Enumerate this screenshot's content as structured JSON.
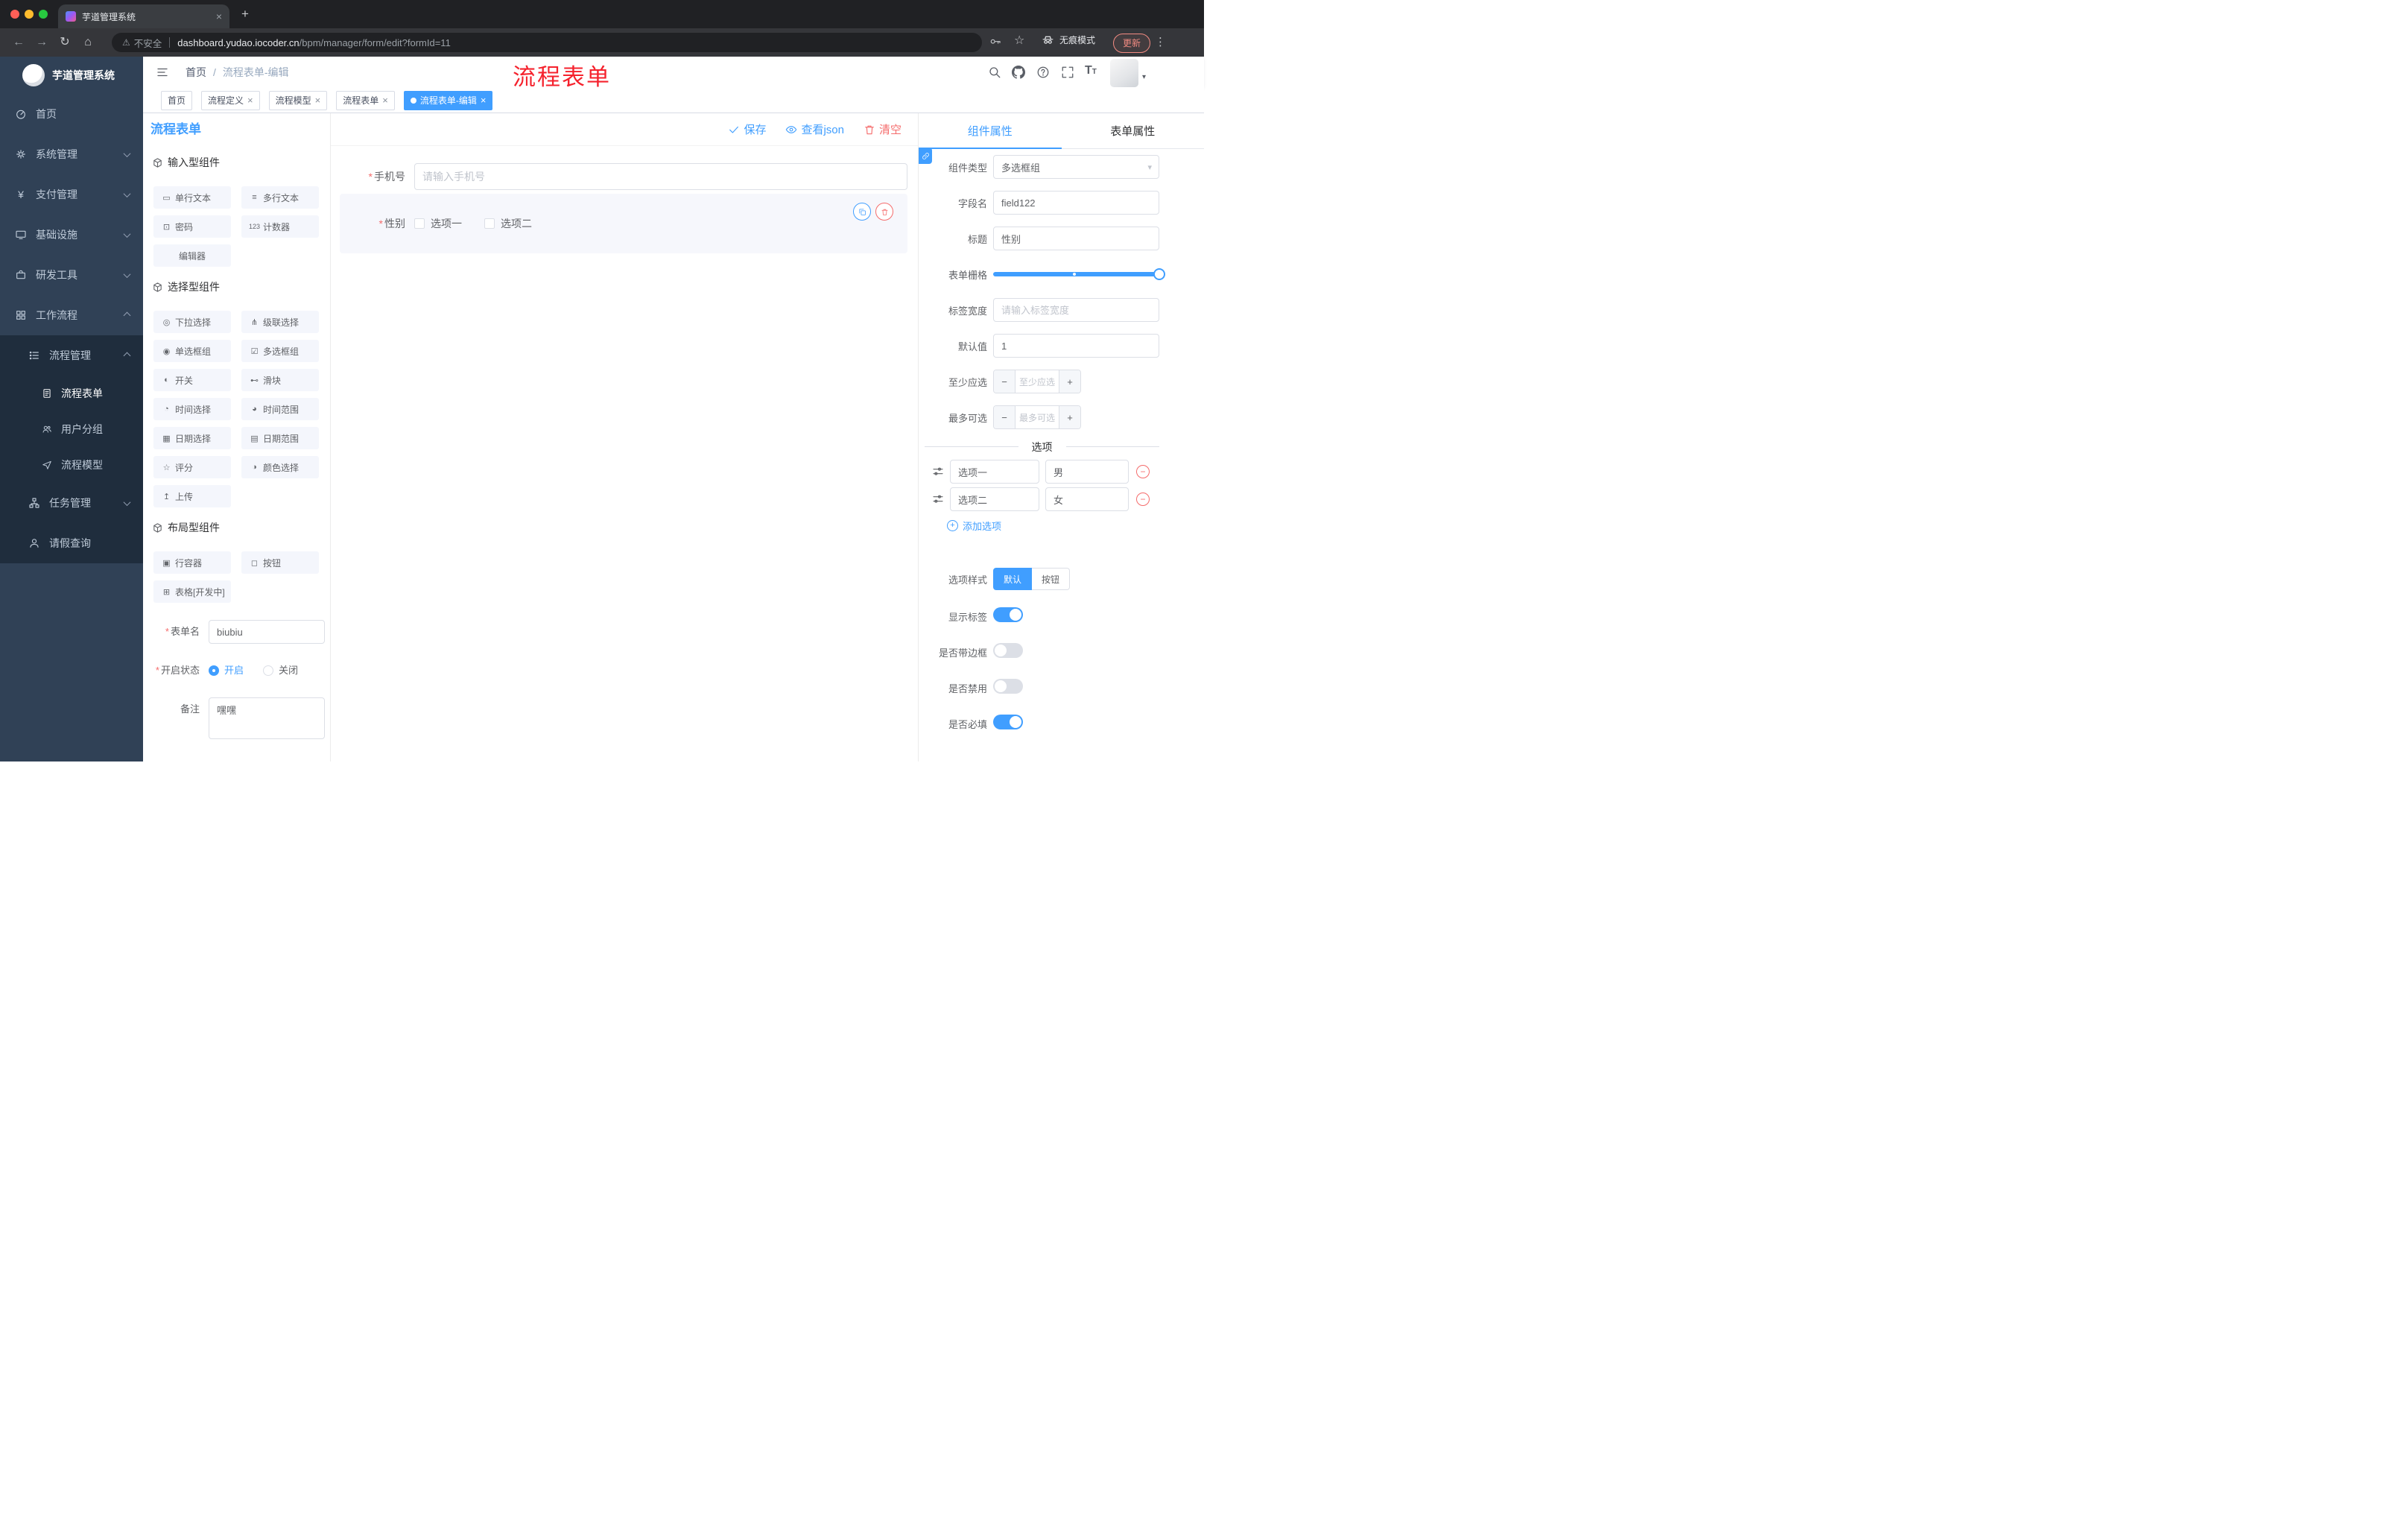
{
  "theme": {
    "accent": "#409EFF",
    "danger": "#F56C6C",
    "annotation_red": "#F5222D",
    "sidebar_bg": "#304156",
    "submenu_bg": "#1F2D3D"
  },
  "glyphs": {
    "close": "×",
    "plus": "+",
    "minus": "−",
    "back": "←",
    "forward": "→",
    "reload": "↻",
    "home": "⌂",
    "star": "☆",
    "menu_dots": "⋮",
    "caret_down": "▾",
    "slash": "/",
    "warning": "⚠",
    "yen": "¥",
    "required": "*"
  },
  "browser": {
    "tab_title": "芋道管理系统",
    "security_label": "不安全",
    "url_host": "dashboard.yudao.iocoder.cn",
    "url_path": "/bpm/manager/form/edit?formId=11",
    "incognito_label": "无痕模式",
    "update_label": "更新"
  },
  "sidebar": {
    "logo_title": "芋道管理系统",
    "items": [
      {
        "label": "首页"
      },
      {
        "label": "系统管理"
      },
      {
        "label": "支付管理"
      },
      {
        "label": "基础设施"
      },
      {
        "label": "研发工具"
      },
      {
        "label": "工作流程"
      },
      {
        "label": "流程管理"
      },
      {
        "label": "流程表单"
      },
      {
        "label": "用户分组"
      },
      {
        "label": "流程模型"
      },
      {
        "label": "任务管理"
      },
      {
        "label": "请假查询"
      }
    ]
  },
  "header": {
    "breadcrumb": [
      "首页",
      "流程表单-编辑"
    ],
    "annotation": "流程表单"
  },
  "tags": [
    {
      "label": "首页"
    },
    {
      "label": "流程定义"
    },
    {
      "label": "流程模型"
    },
    {
      "label": "流程表单"
    },
    {
      "label": "流程表单-编辑"
    }
  ],
  "designer": {
    "title": "流程表单",
    "actions": {
      "save": "保存",
      "view_json": "查看json",
      "clear": "清空"
    },
    "groups": [
      {
        "title": "输入型组件",
        "items": [
          {
            "label": "单行文本",
            "icon": "▭"
          },
          {
            "label": "多行文本",
            "icon": "≡"
          },
          {
            "label": "密码",
            "icon": "⊡"
          },
          {
            "label": "计数器",
            "icon": "123"
          },
          {
            "label": "编辑器",
            "icon": ""
          }
        ]
      },
      {
        "title": "选择型组件",
        "items": [
          {
            "label": "下拉选择",
            "icon": "◎"
          },
          {
            "label": "级联选择",
            "icon": "⋔"
          },
          {
            "label": "单选框组",
            "icon": "◉"
          },
          {
            "label": "多选框组",
            "icon": "☑"
          },
          {
            "label": "开关",
            "icon": "◐"
          },
          {
            "label": "滑块",
            "icon": "⊷"
          },
          {
            "label": "时间选择",
            "icon": "◔"
          },
          {
            "label": "时间范围",
            "icon": "◕"
          },
          {
            "label": "日期选择",
            "icon": "▦"
          },
          {
            "label": "日期范围",
            "icon": "▤"
          },
          {
            "label": "评分",
            "icon": "☆"
          },
          {
            "label": "颜色选择",
            "icon": "◑"
          },
          {
            "label": "上传",
            "icon": "↥"
          }
        ]
      },
      {
        "title": "布局型组件",
        "items": [
          {
            "label": "行容器",
            "icon": "▣"
          },
          {
            "label": "按钮",
            "icon": "◻"
          },
          {
            "label": "表格[开发中]",
            "icon": "⊞"
          }
        ]
      }
    ],
    "form_meta": {
      "name_label": "表单名",
      "name_value": "biubiu",
      "status_label": "开启状态",
      "status_on": "开启",
      "status_off": "关闭",
      "remark_label": "备注",
      "remark_value": "嘿嘿"
    }
  },
  "canvas": {
    "phone": {
      "label": "手机号",
      "placeholder": "请输入手机号"
    },
    "gender": {
      "label": "性别",
      "options": [
        "选项一",
        "选项二"
      ]
    }
  },
  "props": {
    "tabs": [
      "组件属性",
      "表单属性"
    ],
    "rows": {
      "component_type": {
        "label": "组件类型",
        "value": "多选框组"
      },
      "field_name": {
        "label": "字段名",
        "value": "field122"
      },
      "title": {
        "label": "标题",
        "value": "性别"
      },
      "grid": {
        "label": "表单栅格"
      },
      "label_width": {
        "label": "标签宽度",
        "placeholder": "请输入标签宽度"
      },
      "default_value": {
        "label": "默认值",
        "value": "1"
      },
      "min_select": {
        "label": "至少应选",
        "placeholder": "至少应选"
      },
      "max_select": {
        "label": "最多可选",
        "placeholder": "最多可选"
      }
    },
    "options_divider": "选项",
    "options": [
      {
        "label": "选项一",
        "value": "男"
      },
      {
        "label": "选项二",
        "value": "女"
      }
    ],
    "add_option": "添加选项",
    "option_style": {
      "label": "选项样式",
      "choices": [
        "默认",
        "按钮"
      ],
      "selected": "默认"
    },
    "switches": [
      {
        "label": "显示标签",
        "on": true
      },
      {
        "label": "是否带边框",
        "on": false
      },
      {
        "label": "是否禁用",
        "on": false
      },
      {
        "label": "是否必填",
        "on": true
      }
    ]
  }
}
